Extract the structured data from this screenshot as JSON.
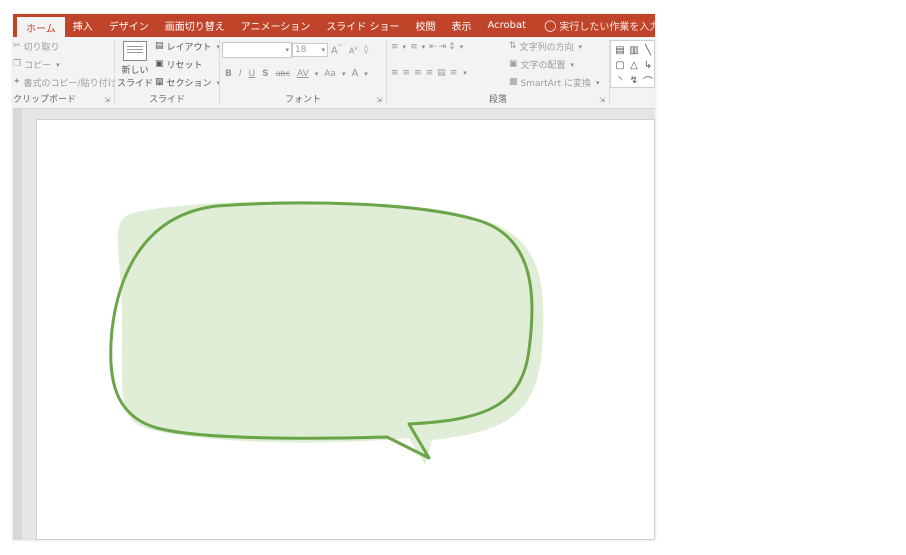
{
  "tabs": [
    {
      "id": "home",
      "label": "ホーム",
      "active": true
    },
    {
      "id": "insert",
      "label": "挿入"
    },
    {
      "id": "design",
      "label": "デザイン"
    },
    {
      "id": "transitions",
      "label": "画面切り替え"
    },
    {
      "id": "animations",
      "label": "アニメーション"
    },
    {
      "id": "slideshow",
      "label": "スライド ショー"
    },
    {
      "id": "review",
      "label": "校閲"
    },
    {
      "id": "view",
      "label": "表示"
    },
    {
      "id": "acrobat",
      "label": "Acrobat"
    }
  ],
  "tell_me": "実行したい作業を入力してください...",
  "clipboard": {
    "cut": "切り取り",
    "copy": "コピー",
    "format_painter": "書式のコピー/貼り付け",
    "label": "クリップボード"
  },
  "slides_group": {
    "new_slide_1": "新しい",
    "new_slide_2": "スライド",
    "layout": "レイアウト",
    "reset": "リセット",
    "section": "セクション",
    "label": "スライド"
  },
  "font_group": {
    "font_name": "",
    "font_size": "18",
    "grow": "A",
    "shrink": "A",
    "bold": "B",
    "italic": "I",
    "underline": "U",
    "shadow": "S",
    "strike": "abc",
    "spacing": "AV",
    "case": "Aa",
    "color": "A",
    "label": "フォント"
  },
  "paragraph_group": {
    "text_direction": "文字列の方向",
    "align_text": "文字の配置",
    "smartart": "SmartArt に変換",
    "label": "段落"
  },
  "colors": {
    "accent": "#c0442a",
    "bubble_fill": "#e0eed7",
    "bubble_stroke": "#6aa54a"
  }
}
